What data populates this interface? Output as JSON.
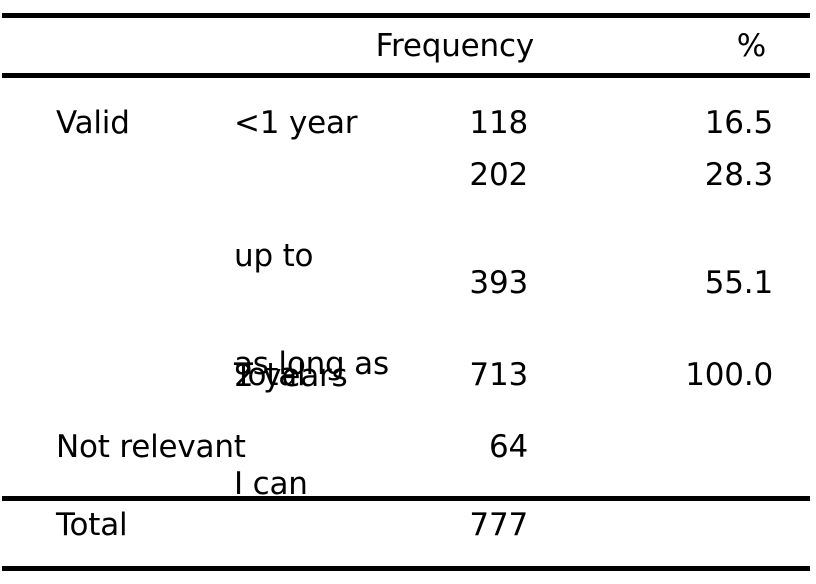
{
  "table": {
    "columns": [
      {
        "key": "group",
        "header": ""
      },
      {
        "key": "category",
        "header": ""
      },
      {
        "key": "frequency",
        "header": "Frequency"
      },
      {
        "key": "percent",
        "header": "%"
      }
    ],
    "header": {
      "frequency": "Frequency",
      "percent": "%"
    },
    "groups": {
      "valid": "Valid",
      "not_relevant": "Not relevant",
      "total": "Total"
    },
    "rows": [
      {
        "group": "Valid",
        "category_line1": "<1 year",
        "category_line2": "",
        "frequency": "118",
        "percent": "16.5"
      },
      {
        "group": "",
        "category_line1": "up to",
        "category_line2": "2 years",
        "frequency": "202",
        "percent": "28.3"
      },
      {
        "group": "",
        "category_line1": "as long as",
        "category_line2": "I can",
        "frequency": "393",
        "percent": "55.1"
      },
      {
        "group": "",
        "category_line1": "Total",
        "category_line2": "",
        "frequency": "713",
        "percent": "100.0"
      },
      {
        "group": "Not relevant",
        "category_line1": "",
        "category_line2": "",
        "frequency": "64",
        "percent": ""
      },
      {
        "group": "Total",
        "category_line1": "",
        "category_line2": "",
        "frequency": "777",
        "percent": ""
      }
    ]
  },
  "chart_data": {
    "type": "table",
    "title": "",
    "columns": [
      "",
      "",
      "Frequency",
      "%"
    ],
    "categories": [
      "<1 year",
      "up to 2 years",
      "as long as I can",
      "Total",
      "Not relevant",
      "Total"
    ],
    "series": [
      {
        "name": "Frequency",
        "values": [
          118,
          202,
          393,
          713,
          64,
          777
        ]
      },
      {
        "name": "%",
        "values": [
          16.5,
          28.3,
          55.1,
          100.0,
          null,
          null
        ]
      }
    ],
    "grid": false,
    "legend": "none"
  }
}
